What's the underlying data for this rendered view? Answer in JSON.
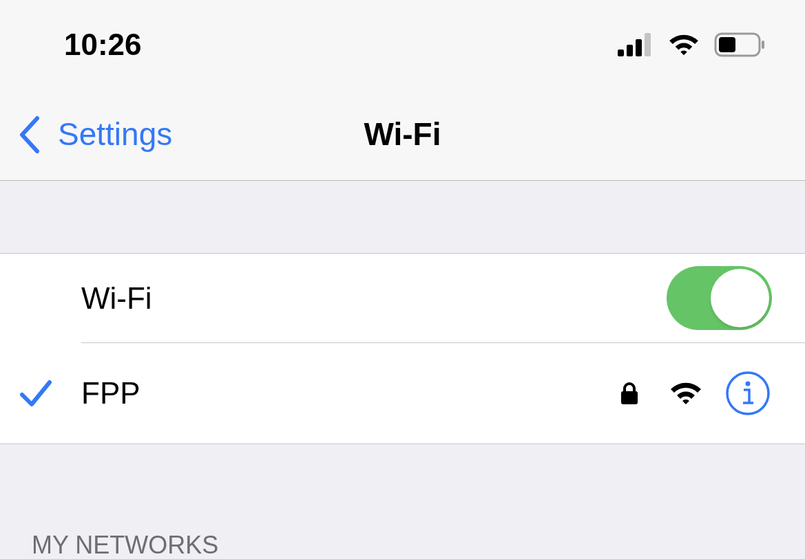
{
  "status_bar": {
    "time": "10:26"
  },
  "nav_bar": {
    "back_label": "Settings",
    "title": "Wi-Fi"
  },
  "wifi_row": {
    "label": "Wi-Fi",
    "on": true
  },
  "networks": [
    {
      "name": "FPP",
      "selected": true,
      "locked": true
    }
  ],
  "section_header": "MY NETWORKS"
}
